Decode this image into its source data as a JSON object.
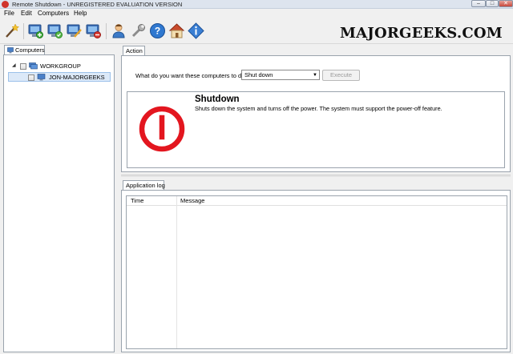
{
  "window": {
    "title": "Remote Shutdown - UNREGISTERED EVALUATION VERSION",
    "min_label": "–",
    "max_label": "□",
    "close_label": "✕"
  },
  "menu": [
    "File",
    "Edit",
    "Computers",
    "Help"
  ],
  "toolbar": {
    "icons": [
      "magic-wand-icon",
      "add-computer-icon",
      "add-computer-green-icon",
      "edit-computer-icon",
      "remove-computer-icon",
      "user-icon",
      "wrench-icon",
      "help-icon",
      "home-icon",
      "info-icon"
    ],
    "brand": "MAJORGEEKS.COM"
  },
  "computers_panel": {
    "tab_label": "Computers",
    "tree": [
      {
        "label": "WORKGROUP",
        "expander": "◢"
      },
      {
        "label": "JON-MAJORGEEKS"
      }
    ]
  },
  "action": {
    "tab_label": "Action",
    "question": "What do you want these computers to do:",
    "selected": "Shut down",
    "combo_arrow": "▼",
    "execute_label": "Execute",
    "title": "Shutdown",
    "description": "Shuts down the system and turns off the power. The system must support the power-off feature.",
    "accent": "#e3161f"
  },
  "log": {
    "tab_label": "Application log",
    "columns": [
      "Time",
      "Message"
    ],
    "rows": []
  }
}
